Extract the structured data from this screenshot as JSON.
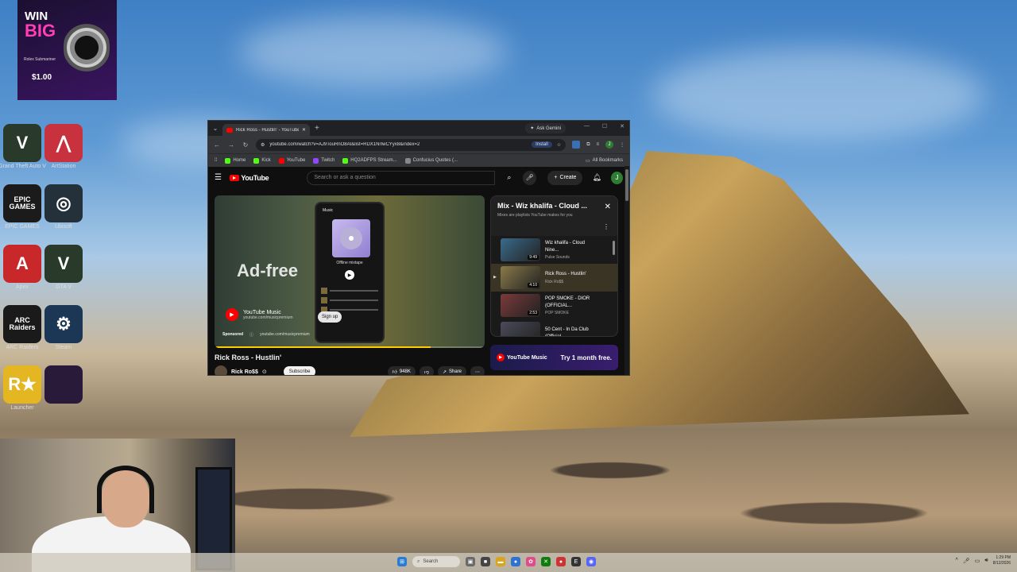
{
  "desktop": {
    "ad": {
      "line1": "WIN",
      "line2": "BIG",
      "product": "Rolex Submariner",
      "price": "$1.00"
    },
    "icons": [
      {
        "id": "gta",
        "label": "Grand Theft Auto V",
        "glyph": "V",
        "color": "#2a3a2a"
      },
      {
        "id": "artstation",
        "label": "ArtStation",
        "glyph": "⋀",
        "color": "#c8323f"
      },
      {
        "id": "epic",
        "label": "EPIC GAMES",
        "glyph": "EPIC\nGAMES",
        "color": "#1b1b1b"
      },
      {
        "id": "ubisoft",
        "label": "Ubisoft",
        "glyph": "◎",
        "color": "#24303a"
      },
      {
        "id": "apex",
        "label": "Apex",
        "glyph": "A",
        "color": "#c8282a"
      },
      {
        "id": "gta2",
        "label": "GTA V",
        "glyph": "V",
        "color": "#2a3a2a"
      },
      {
        "id": "arc",
        "label": "ARC Raiders",
        "glyph": "ARC\nRaiders",
        "color": "#1a1a1a"
      },
      {
        "id": "steam",
        "label": "Steam",
        "glyph": "⚙",
        "color": "#1c3756"
      },
      {
        "id": "rockstar",
        "label": "Launcher",
        "glyph": "R★",
        "color": "#e3b622"
      },
      {
        "id": "fivem",
        "label": "",
        "glyph": "",
        "color": "#2a1a3a"
      }
    ]
  },
  "browser": {
    "tab_title": "Rick Ross - Hustlin' - YouTube",
    "ask_gemini": "Ask Gemini",
    "url": "youtube.com/watch?v=AJ9TouRnO8AI&list=RDX1NrIwCYyx8&index=2",
    "install": "Install",
    "bookmarks": [
      {
        "label": "Home",
        "color": "#53fc18"
      },
      {
        "label": "Kick",
        "color": "#53fc18"
      },
      {
        "label": "YouTube",
        "color": "#ff0000"
      },
      {
        "label": "Twitch",
        "color": "#9146ff"
      },
      {
        "label": "HQ2ADFPS Stream...",
        "color": "#53fc18"
      },
      {
        "label": "Confucius Quotes (...",
        "color": "#888888"
      }
    ],
    "all_bookmarks": "All Bookmarks"
  },
  "youtube": {
    "logo": "YouTube",
    "search_placeholder": "Search or ask a question",
    "create": "Create",
    "avatar_letter": "J",
    "ad": {
      "headline": "Ad-free",
      "phone_app": "Music",
      "phone_caption": "Offline mixtape",
      "brand": "YouTube Music",
      "brand_url": "youtube.com/musicpremium",
      "signup": "Sign up",
      "sponsored": "Sponsored",
      "sponsored_url": "youtube.com/musicpremium"
    },
    "video_title": "Rick Ross - Hustlin'",
    "channel": "Rick Ro$$",
    "subscribe": "Subscribe",
    "likes": "948K",
    "share": "Share",
    "mix": {
      "title": "Mix - Wiz khalifa - Cloud ...",
      "subtitle": "Mixes are playlists YouTube makes for you",
      "items": [
        {
          "song": "Wiz khalifa - Cloud Nine...",
          "artist": "Pulse Sounds",
          "duration": "9:49",
          "thumb": "#3a6a8a"
        },
        {
          "song": "Rick Ross - Hustlin'",
          "artist": "Rick Ro$$",
          "duration": "4:10",
          "thumb": "#8a7a4a"
        },
        {
          "song": "POP SMOKE - DIOR (OFFICIAL...",
          "artist": "POP SMOKE",
          "duration": "2:53",
          "thumb": "#7a3a3a"
        },
        {
          "song": "50 Cent - In Da Club (Official...",
          "artist": "",
          "duration": "",
          "thumb": "#4a4a5a"
        }
      ]
    },
    "banner": {
      "logo": "YouTube Music",
      "cta": "Try 1 month free."
    }
  },
  "taskbar": {
    "search": "Search",
    "time": "1:29 PM",
    "date": "8/12/2026"
  }
}
